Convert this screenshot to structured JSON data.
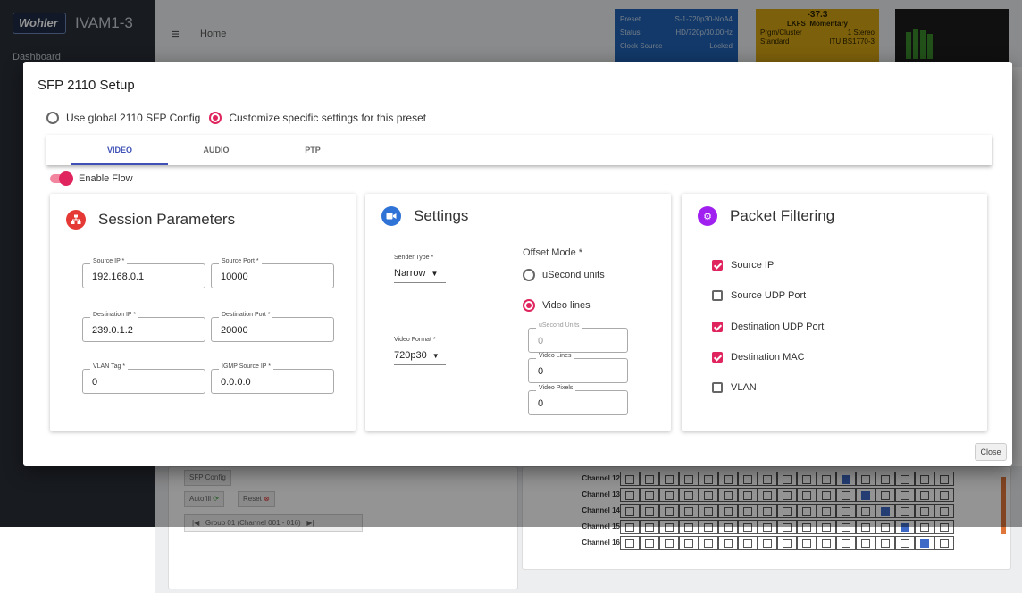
{
  "app": {
    "logo": "Wohler",
    "name": "IVAM1-3",
    "nav_dashboard": "Dashboard",
    "breadcrumb_home": "Home"
  },
  "header": {
    "preset": {
      "label": "Preset",
      "value": "S-1-720p30-NoA4"
    },
    "status": {
      "label": "Status",
      "value": "HD/720p/30.00Hz"
    },
    "clock": {
      "label": "Clock Source",
      "value": "Locked"
    },
    "loudness": {
      "value": "-37.3",
      "lkfs": "LKFS",
      "mode": "Momentary",
      "prgm_label": "Prgm/Cluster",
      "prgm_value": "1 Stereo",
      "standard_label": "Standard",
      "standard_value": "ITU BS1770-3"
    },
    "accent_blue": "#1f63b5",
    "accent_yellow": "#d8a614"
  },
  "background": {
    "sfp_config": "SFP Config",
    "autofill": "Autofill",
    "reset": "Reset",
    "group": "Group 01 (Channel 001 - 016)",
    "channels": [
      "Channel 12",
      "Channel 13",
      "Channel 14",
      "Channel 15",
      "Channel 16"
    ]
  },
  "dialog": {
    "title": "SFP 2110 Setup",
    "global_option": "Use global 2110 SFP Config",
    "custom_option": "Customize specific settings for this preset",
    "tabs": [
      "VIDEO",
      "AUDIO",
      "PTP"
    ],
    "active_tab": "VIDEO",
    "enable_flow": "Enable Flow",
    "close": "Close",
    "accent": "#e0245e",
    "tab_accent": "#3f51b5"
  },
  "session": {
    "title": "Session Parameters",
    "fields": {
      "source_ip": {
        "label": "Source IP *",
        "value": "192.168.0.1"
      },
      "source_port": {
        "label": "Source Port *",
        "value": "10000"
      },
      "dest_ip": {
        "label": "Destination IP *",
        "value": "239.0.1.2"
      },
      "dest_port": {
        "label": "Destination Port *",
        "value": "20000"
      },
      "vlan": {
        "label": "VLAN Tag *",
        "value": "0"
      },
      "igmp": {
        "label": "IGMP Source IP *",
        "value": "0.0.0.0"
      }
    }
  },
  "settings": {
    "title": "Settings",
    "sender_type": {
      "label": "Sender Type *",
      "value": "Narrow"
    },
    "video_format": {
      "label": "Video Format *",
      "value": "720p30"
    },
    "offset_mode": "Offset Mode *",
    "opt_usecond": "uSecond units",
    "opt_video_lines": "Video lines",
    "usecond_units": {
      "label": "uSecond Units",
      "value": "0"
    },
    "video_lines": {
      "label": "Video Lines",
      "value": "0"
    },
    "video_pixels": {
      "label": "Video Pixels",
      "value": "0"
    }
  },
  "packet": {
    "title": "Packet Filtering",
    "items": [
      {
        "label": "Source IP",
        "checked": true
      },
      {
        "label": "Source UDP Port",
        "checked": false
      },
      {
        "label": "Destination UDP Port",
        "checked": true
      },
      {
        "label": "Destination MAC",
        "checked": true
      },
      {
        "label": "VLAN",
        "checked": false
      }
    ]
  }
}
